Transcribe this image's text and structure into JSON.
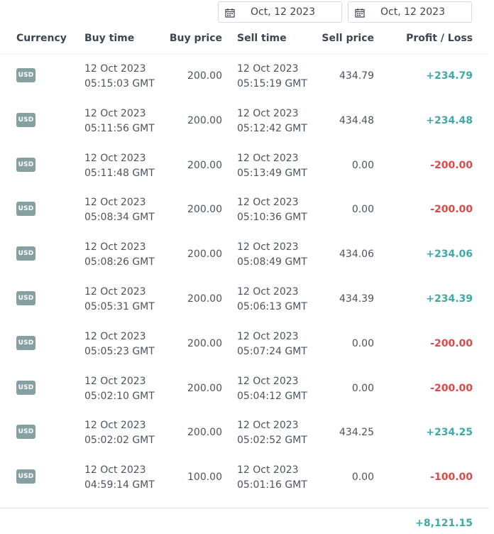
{
  "date_filter": {
    "from": "Oct, 12 2023",
    "to": "Oct, 12 2023"
  },
  "columns": {
    "currency": "Currency",
    "buy_time": "Buy time",
    "buy_price": "Buy price",
    "sell_time": "Sell time",
    "sell_price": "Sell price",
    "profit_loss": "Profit / Loss"
  },
  "colors": {
    "positive": "#3fa9a7",
    "negative": "#e04848",
    "badge": "#86a0a2"
  },
  "rows": [
    {
      "currency": "USD",
      "buy_date": "12 Oct 2023",
      "buy_time": "05:15:03 GMT",
      "buy_price": "200.00",
      "sell_date": "12 Oct 2023",
      "sell_time": "05:15:19 GMT",
      "sell_price": "434.79",
      "profit": "+234.79"
    },
    {
      "currency": "USD",
      "buy_date": "12 Oct 2023",
      "buy_time": "05:11:56 GMT",
      "buy_price": "200.00",
      "sell_date": "12 Oct 2023",
      "sell_time": "05:12:42 GMT",
      "sell_price": "434.48",
      "profit": "+234.48"
    },
    {
      "currency": "USD",
      "buy_date": "12 Oct 2023",
      "buy_time": "05:11:48 GMT",
      "buy_price": "200.00",
      "sell_date": "12 Oct 2023",
      "sell_time": "05:13:49 GMT",
      "sell_price": "0.00",
      "profit": "-200.00"
    },
    {
      "currency": "USD",
      "buy_date": "12 Oct 2023",
      "buy_time": "05:08:34 GMT",
      "buy_price": "200.00",
      "sell_date": "12 Oct 2023",
      "sell_time": "05:10:36 GMT",
      "sell_price": "0.00",
      "profit": "-200.00"
    },
    {
      "currency": "USD",
      "buy_date": "12 Oct 2023",
      "buy_time": "05:08:26 GMT",
      "buy_price": "200.00",
      "sell_date": "12 Oct 2023",
      "sell_time": "05:08:49 GMT",
      "sell_price": "434.06",
      "profit": "+234.06"
    },
    {
      "currency": "USD",
      "buy_date": "12 Oct 2023",
      "buy_time": "05:05:31 GMT",
      "buy_price": "200.00",
      "sell_date": "12 Oct 2023",
      "sell_time": "05:06:13 GMT",
      "sell_price": "434.39",
      "profit": "+234.39"
    },
    {
      "currency": "USD",
      "buy_date": "12 Oct 2023",
      "buy_time": "05:05:23 GMT",
      "buy_price": "200.00",
      "sell_date": "12 Oct 2023",
      "sell_time": "05:07:24 GMT",
      "sell_price": "0.00",
      "profit": "-200.00"
    },
    {
      "currency": "USD",
      "buy_date": "12 Oct 2023",
      "buy_time": "05:02:10 GMT",
      "buy_price": "200.00",
      "sell_date": "12 Oct 2023",
      "sell_time": "05:04:12 GMT",
      "sell_price": "0.00",
      "profit": "-200.00"
    },
    {
      "currency": "USD",
      "buy_date": "12 Oct 2023",
      "buy_time": "05:02:02 GMT",
      "buy_price": "200.00",
      "sell_date": "12 Oct 2023",
      "sell_time": "05:02:52 GMT",
      "sell_price": "434.25",
      "profit": "+234.25"
    },
    {
      "currency": "USD",
      "buy_date": "12 Oct 2023",
      "buy_time": "04:59:14 GMT",
      "buy_price": "100.00",
      "sell_date": "12 Oct 2023",
      "sell_time": "05:01:16 GMT",
      "sell_price": "0.00",
      "profit": "-100.00"
    }
  ],
  "total": "+8,121.15"
}
